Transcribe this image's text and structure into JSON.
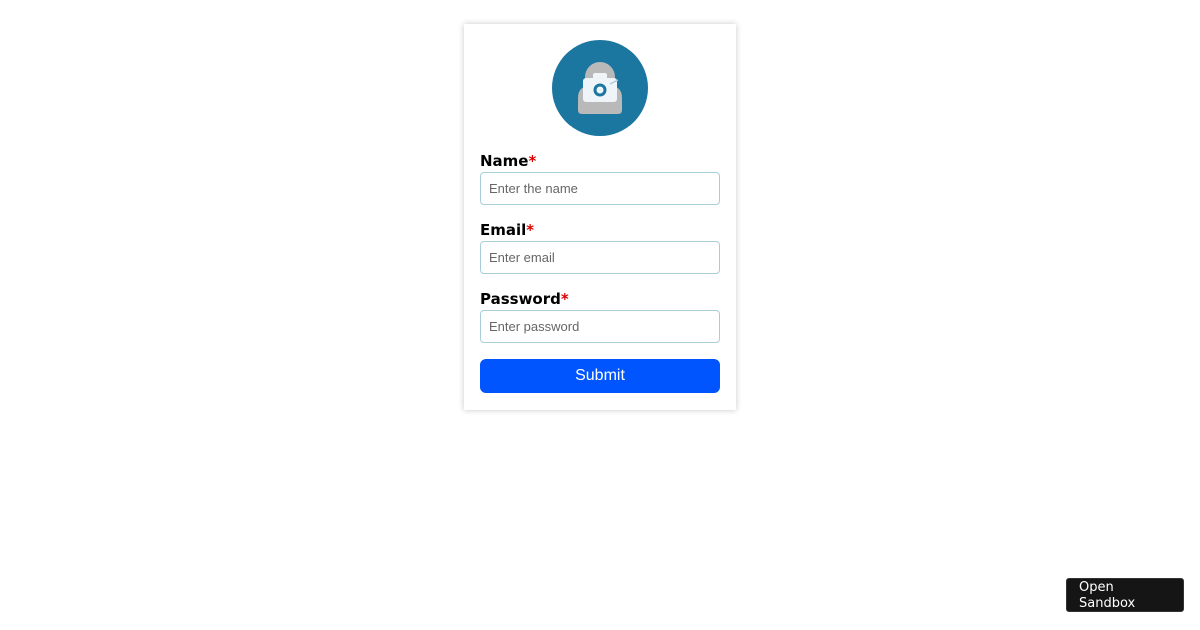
{
  "form": {
    "avatar_icon": "upload-photo-icon",
    "fields": [
      {
        "label": "Name",
        "required_mark": "*",
        "placeholder": "Enter the name",
        "value": ""
      },
      {
        "label": "Email",
        "required_mark": "*",
        "placeholder": "Enter email",
        "value": ""
      },
      {
        "label": "Password",
        "required_mark": "*",
        "placeholder": "Enter password",
        "value": ""
      }
    ],
    "submit_label": "Submit"
  },
  "sandbox_button": {
    "label": "Open Sandbox"
  },
  "colors": {
    "avatar_bg": "#1b76a0",
    "submit_bg": "#0055ff",
    "required": "#e00000",
    "input_border": "#a9cddb"
  }
}
